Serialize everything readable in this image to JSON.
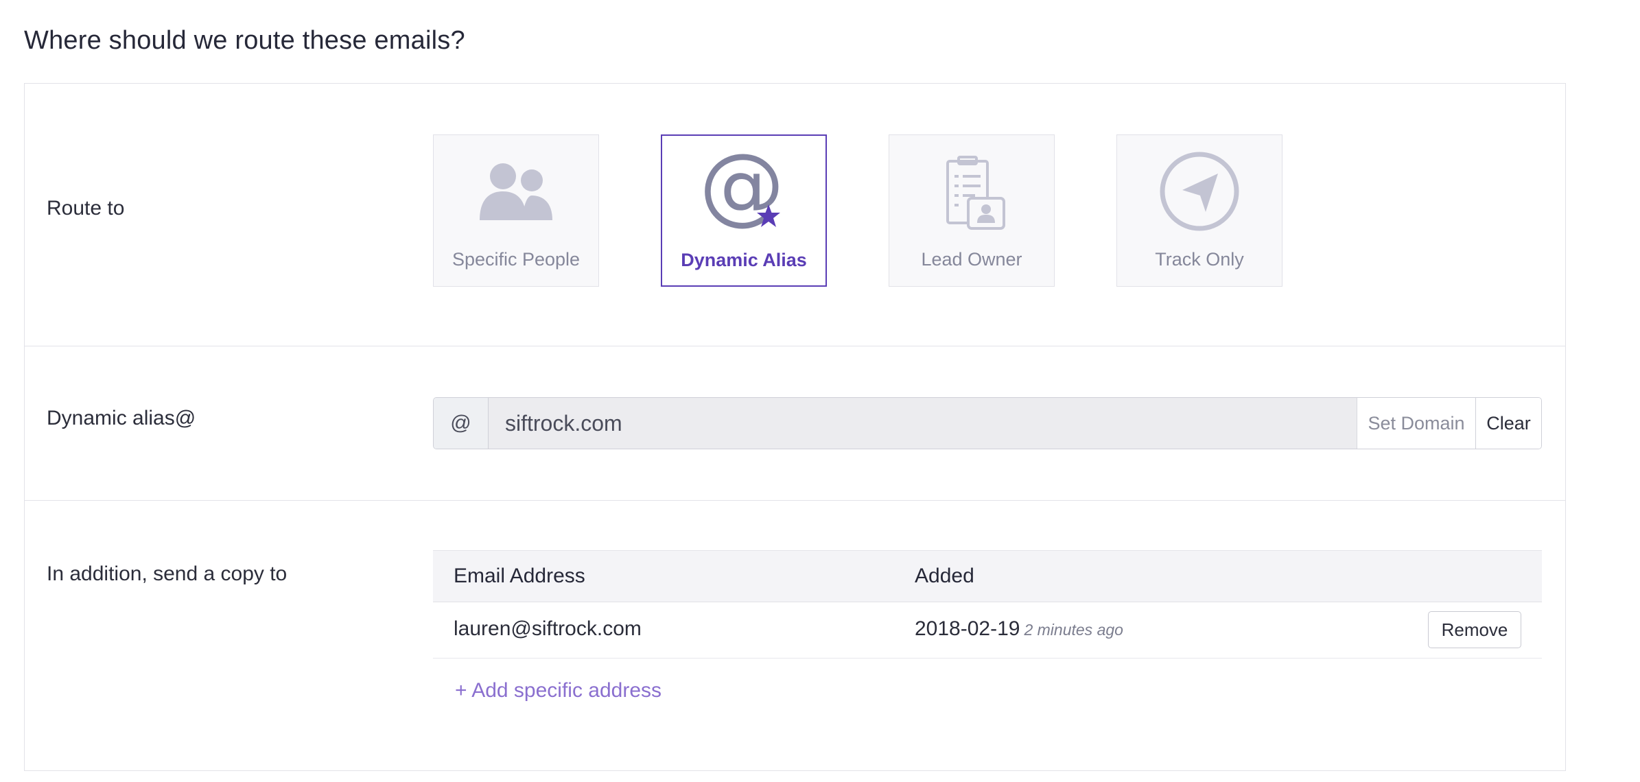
{
  "page": {
    "title": "Where should we route these emails?"
  },
  "route": {
    "label": "Route to",
    "options": [
      {
        "label": "Specific People",
        "icon": "people-icon",
        "selected": false
      },
      {
        "label": "Dynamic Alias",
        "icon": "at-star-icon",
        "selected": true
      },
      {
        "label": "Lead Owner",
        "icon": "clipboard-contact-icon",
        "selected": false
      },
      {
        "label": "Track Only",
        "icon": "navigation-arrow-icon",
        "selected": false
      }
    ]
  },
  "alias": {
    "label": "Dynamic alias@",
    "prefix": "@",
    "value": "siftrock.com",
    "set_domain_label": "Set Domain",
    "clear_label": "Clear"
  },
  "copy": {
    "label": "In addition, send a copy to",
    "columns": [
      "Email Address",
      "Added"
    ],
    "rows": [
      {
        "email": "lauren@siftrock.com",
        "date": "2018-02-19",
        "ago": "2 minutes ago",
        "action": "Remove"
      }
    ],
    "add_label": "+ Add specific address"
  },
  "colors": {
    "accent": "#5a3db5",
    "link": "#8a6fcf",
    "icon_inactive": "#c3c4d3"
  }
}
